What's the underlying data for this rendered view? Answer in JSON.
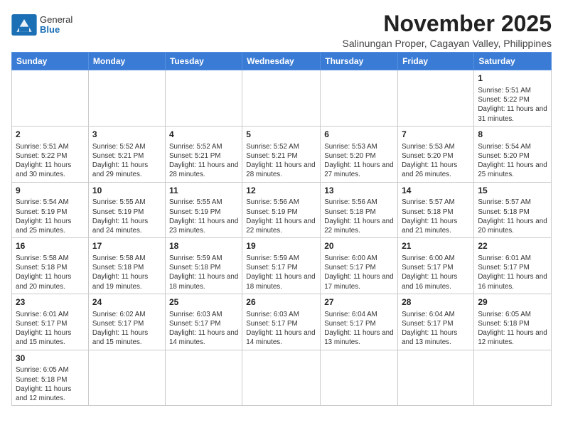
{
  "header": {
    "logo_general": "General",
    "logo_blue": "Blue",
    "month_title": "November 2025",
    "subtitle": "Salinungan Proper, Cagayan Valley, Philippines"
  },
  "weekdays": [
    "Sunday",
    "Monday",
    "Tuesday",
    "Wednesday",
    "Thursday",
    "Friday",
    "Saturday"
  ],
  "weeks": [
    [
      {
        "date": "",
        "info": ""
      },
      {
        "date": "",
        "info": ""
      },
      {
        "date": "",
        "info": ""
      },
      {
        "date": "",
        "info": ""
      },
      {
        "date": "",
        "info": ""
      },
      {
        "date": "",
        "info": ""
      },
      {
        "date": "1",
        "info": "Sunrise: 5:51 AM\nSunset: 5:22 PM\nDaylight: 11 hours\nand 31 minutes."
      }
    ],
    [
      {
        "date": "2",
        "info": "Sunrise: 5:51 AM\nSunset: 5:22 PM\nDaylight: 11 hours\nand 30 minutes."
      },
      {
        "date": "3",
        "info": "Sunrise: 5:52 AM\nSunset: 5:21 PM\nDaylight: 11 hours\nand 29 minutes."
      },
      {
        "date": "4",
        "info": "Sunrise: 5:52 AM\nSunset: 5:21 PM\nDaylight: 11 hours\nand 28 minutes."
      },
      {
        "date": "5",
        "info": "Sunrise: 5:52 AM\nSunset: 5:21 PM\nDaylight: 11 hours\nand 28 minutes."
      },
      {
        "date": "6",
        "info": "Sunrise: 5:53 AM\nSunset: 5:20 PM\nDaylight: 11 hours\nand 27 minutes."
      },
      {
        "date": "7",
        "info": "Sunrise: 5:53 AM\nSunset: 5:20 PM\nDaylight: 11 hours\nand 26 minutes."
      },
      {
        "date": "8",
        "info": "Sunrise: 5:54 AM\nSunset: 5:20 PM\nDaylight: 11 hours\nand 25 minutes."
      }
    ],
    [
      {
        "date": "9",
        "info": "Sunrise: 5:54 AM\nSunset: 5:19 PM\nDaylight: 11 hours\nand 25 minutes."
      },
      {
        "date": "10",
        "info": "Sunrise: 5:55 AM\nSunset: 5:19 PM\nDaylight: 11 hours\nand 24 minutes."
      },
      {
        "date": "11",
        "info": "Sunrise: 5:55 AM\nSunset: 5:19 PM\nDaylight: 11 hours\nand 23 minutes."
      },
      {
        "date": "12",
        "info": "Sunrise: 5:56 AM\nSunset: 5:19 PM\nDaylight: 11 hours\nand 22 minutes."
      },
      {
        "date": "13",
        "info": "Sunrise: 5:56 AM\nSunset: 5:18 PM\nDaylight: 11 hours\nand 22 minutes."
      },
      {
        "date": "14",
        "info": "Sunrise: 5:57 AM\nSunset: 5:18 PM\nDaylight: 11 hours\nand 21 minutes."
      },
      {
        "date": "15",
        "info": "Sunrise: 5:57 AM\nSunset: 5:18 PM\nDaylight: 11 hours\nand 20 minutes."
      }
    ],
    [
      {
        "date": "16",
        "info": "Sunrise: 5:58 AM\nSunset: 5:18 PM\nDaylight: 11 hours\nand 20 minutes."
      },
      {
        "date": "17",
        "info": "Sunrise: 5:58 AM\nSunset: 5:18 PM\nDaylight: 11 hours\nand 19 minutes."
      },
      {
        "date": "18",
        "info": "Sunrise: 5:59 AM\nSunset: 5:18 PM\nDaylight: 11 hours\nand 18 minutes."
      },
      {
        "date": "19",
        "info": "Sunrise: 5:59 AM\nSunset: 5:17 PM\nDaylight: 11 hours\nand 18 minutes."
      },
      {
        "date": "20",
        "info": "Sunrise: 6:00 AM\nSunset: 5:17 PM\nDaylight: 11 hours\nand 17 minutes."
      },
      {
        "date": "21",
        "info": "Sunrise: 6:00 AM\nSunset: 5:17 PM\nDaylight: 11 hours\nand 16 minutes."
      },
      {
        "date": "22",
        "info": "Sunrise: 6:01 AM\nSunset: 5:17 PM\nDaylight: 11 hours\nand 16 minutes."
      }
    ],
    [
      {
        "date": "23",
        "info": "Sunrise: 6:01 AM\nSunset: 5:17 PM\nDaylight: 11 hours\nand 15 minutes."
      },
      {
        "date": "24",
        "info": "Sunrise: 6:02 AM\nSunset: 5:17 PM\nDaylight: 11 hours\nand 15 minutes."
      },
      {
        "date": "25",
        "info": "Sunrise: 6:03 AM\nSunset: 5:17 PM\nDaylight: 11 hours\nand 14 minutes."
      },
      {
        "date": "26",
        "info": "Sunrise: 6:03 AM\nSunset: 5:17 PM\nDaylight: 11 hours\nand 14 minutes."
      },
      {
        "date": "27",
        "info": "Sunrise: 6:04 AM\nSunset: 5:17 PM\nDaylight: 11 hours\nand 13 minutes."
      },
      {
        "date": "28",
        "info": "Sunrise: 6:04 AM\nSunset: 5:17 PM\nDaylight: 11 hours\nand 13 minutes."
      },
      {
        "date": "29",
        "info": "Sunrise: 6:05 AM\nSunset: 5:18 PM\nDaylight: 11 hours\nand 12 minutes."
      }
    ],
    [
      {
        "date": "30",
        "info": "Sunrise: 6:05 AM\nSunset: 5:18 PM\nDaylight: 11 hours\nand 12 minutes."
      },
      {
        "date": "",
        "info": ""
      },
      {
        "date": "",
        "info": ""
      },
      {
        "date": "",
        "info": ""
      },
      {
        "date": "",
        "info": ""
      },
      {
        "date": "",
        "info": ""
      },
      {
        "date": "",
        "info": ""
      }
    ]
  ]
}
